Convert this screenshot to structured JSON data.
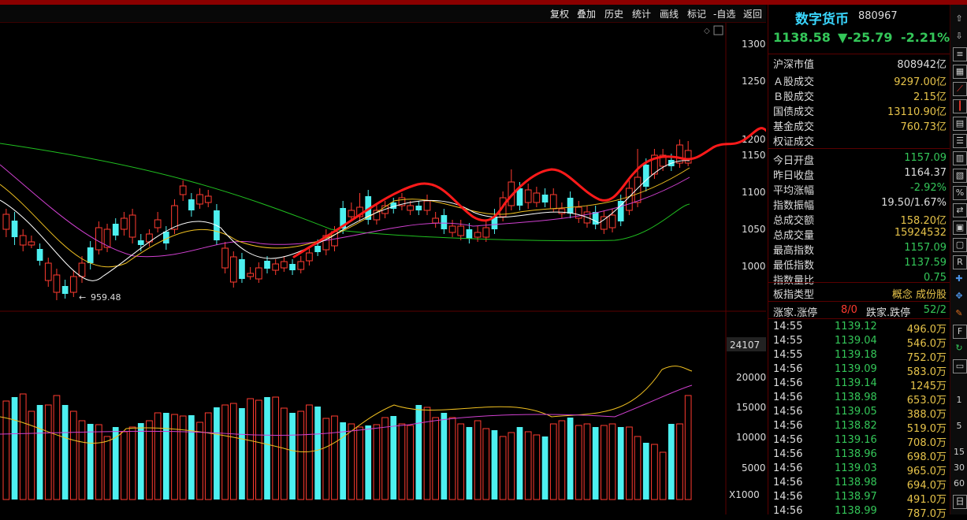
{
  "toolbar": {
    "items": [
      "复权",
      "叠加",
      "历史",
      "统计",
      "画线",
      "标记",
      "-自选",
      "返回"
    ]
  },
  "chart": {
    "price_ticks": [
      "1300",
      "1250",
      "1200",
      "1150",
      "1100",
      "1050",
      "1000"
    ],
    "volume_ticks": [
      "20000",
      "15000",
      "10000",
      "5000"
    ],
    "volume_top_label": "24107",
    "volume_unit": "X1000",
    "low_annotation": "959.48"
  },
  "header": {
    "name": "数字货币",
    "code": "880967",
    "price": "1138.58",
    "change": "▼-25.79",
    "percent": "-2.21%"
  },
  "stats": [
    {
      "k": "沪深市值",
      "v": "808942亿",
      "c": "#dddddd"
    },
    {
      "k": "Ａ股成交",
      "v": "9297.00亿",
      "c": "#e6c34a"
    },
    {
      "k": "Ｂ股成交",
      "v": "2.15亿",
      "c": "#e6c34a"
    },
    {
      "k": "国债成交",
      "v": "13110.90亿",
      "c": "#e6c34a"
    },
    {
      "k": "基金成交",
      "v": "760.73亿",
      "c": "#e6c34a"
    },
    {
      "k": "权证成交",
      "v": "",
      "c": "#e6c34a"
    },
    {
      "k": "今日开盘",
      "v": "1157.09",
      "c": "#34c759"
    },
    {
      "k": "昨日收盘",
      "v": "1164.37",
      "c": "#dddddd"
    },
    {
      "k": "平均涨幅",
      "v": "-2.92%",
      "c": "#34c759"
    },
    {
      "k": "指数振幅",
      "v": "19.50/1.67%",
      "c": "#dddddd"
    },
    {
      "k": "总成交额",
      "v": "158.20亿",
      "c": "#e6c34a"
    },
    {
      "k": "总成交量",
      "v": "15924532",
      "c": "#e6c34a"
    },
    {
      "k": "最高指数",
      "v": "1157.09",
      "c": "#34c759"
    },
    {
      "k": "最低指数",
      "v": "1137.59",
      "c": "#34c759"
    },
    {
      "k": "指数量比",
      "v": "0.75",
      "c": "#34c759"
    }
  ],
  "board": {
    "k": "板指类型",
    "v": "概念 成份股"
  },
  "updown": {
    "k1": "涨家.涨停",
    "v1": "8/0",
    "k2": "跌家.跌停",
    "v2": "52/2"
  },
  "ticks": [
    [
      "14:55",
      "1139.12",
      "496.0万"
    ],
    [
      "14:55",
      "1139.04",
      "546.0万"
    ],
    [
      "14:55",
      "1139.18",
      "752.0万"
    ],
    [
      "14:56",
      "1139.09",
      "583.0万"
    ],
    [
      "14:56",
      "1139.14",
      "1245万"
    ],
    [
      "14:56",
      "1138.98",
      "653.0万"
    ],
    [
      "14:56",
      "1139.05",
      "388.0万"
    ],
    [
      "14:56",
      "1138.82",
      "519.0万"
    ],
    [
      "14:56",
      "1139.16",
      "708.0万"
    ],
    [
      "14:56",
      "1138.96",
      "698.0万"
    ],
    [
      "14:56",
      "1139.03",
      "965.0万"
    ],
    [
      "14:56",
      "1138.98",
      "694.0万"
    ],
    [
      "14:56",
      "1138.97",
      "491.0万"
    ],
    [
      "14:56",
      "1138.99",
      "787.0万"
    ]
  ],
  "sidebar": [
    "1",
    "5",
    "15",
    "30",
    "60",
    "日"
  ],
  "colors": {
    "up": "#ff3b30",
    "down": "#4df0f0",
    "bg": "#000000",
    "grid": "#5a0000",
    "ma5": "#ffffff",
    "ma10": "#f0c020",
    "ma20": "#d040d0",
    "ma60": "#20c020",
    "annotation": "#ff1a1a"
  }
}
